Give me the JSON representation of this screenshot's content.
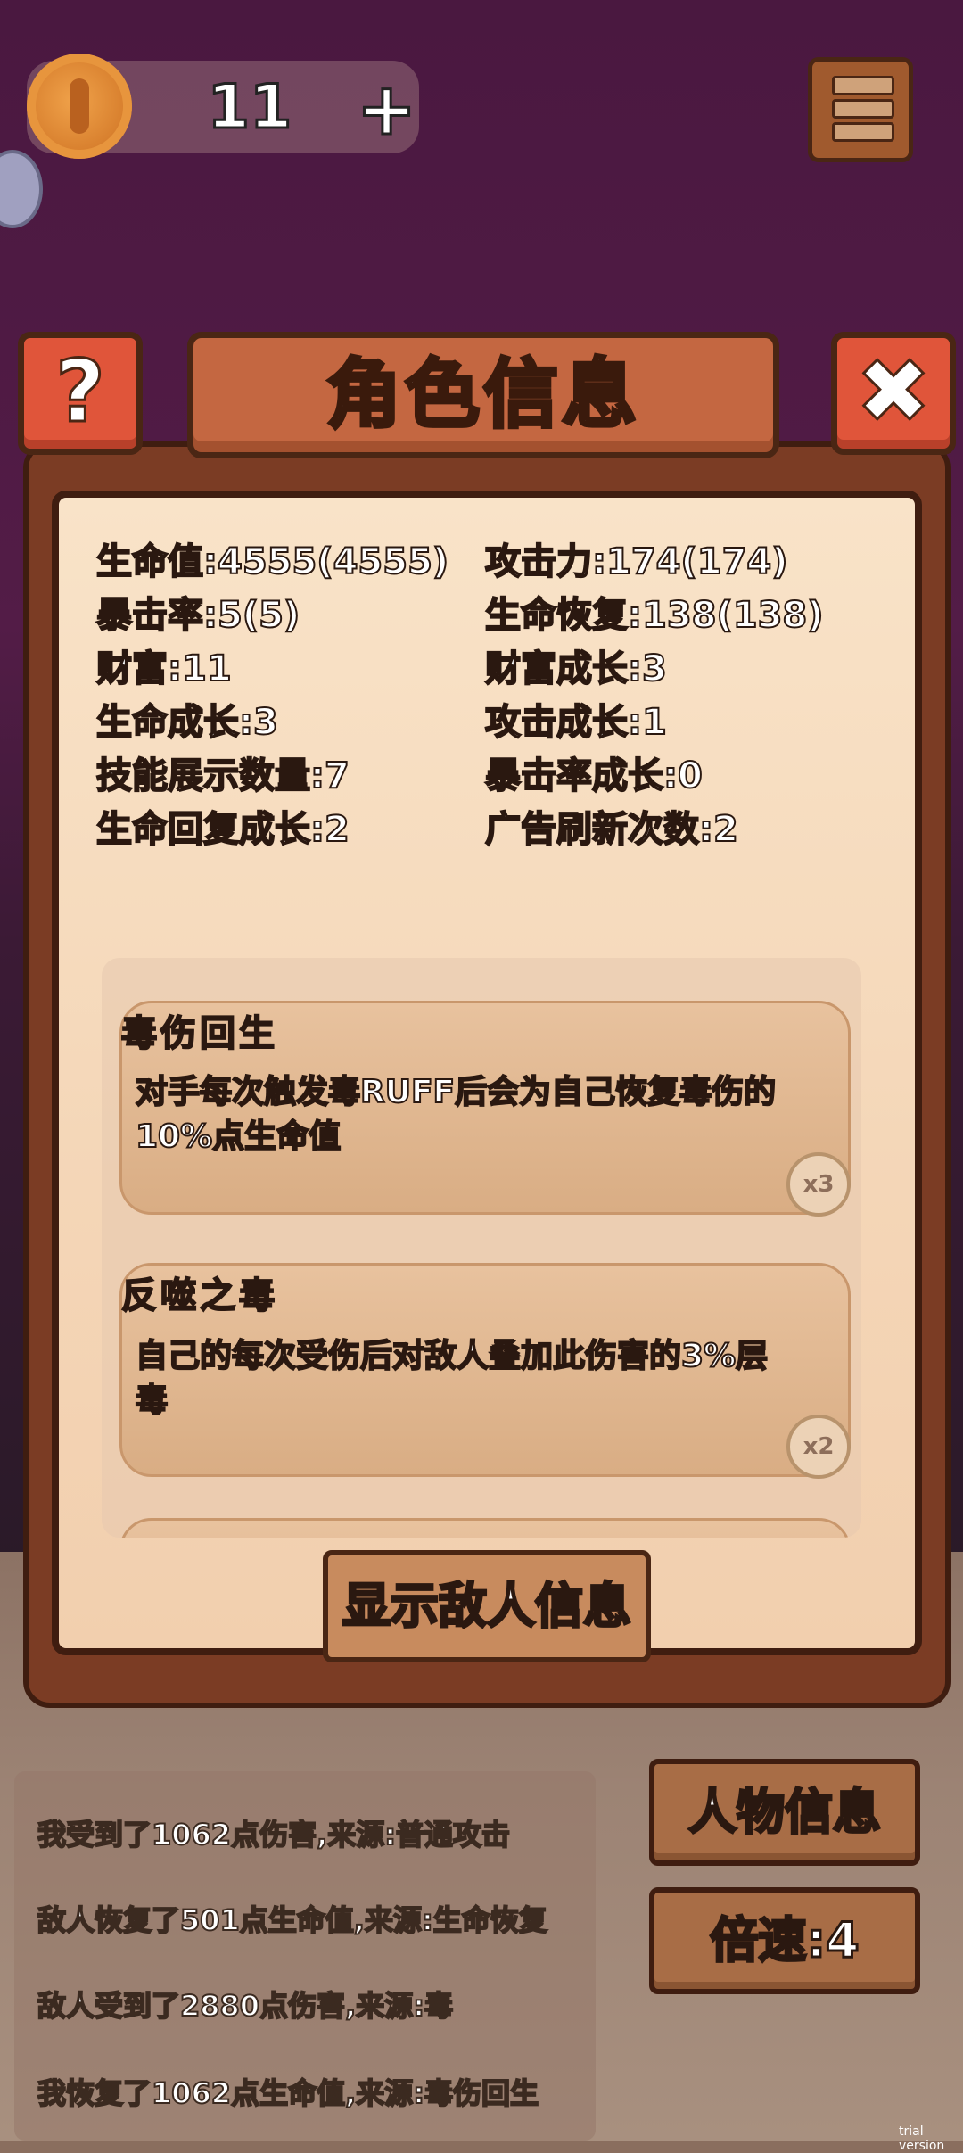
{
  "hud": {
    "coins": "11",
    "plus": "+"
  },
  "panel": {
    "title": "角色信息",
    "help_label": "?",
    "close_label": "✖",
    "stats": [
      {
        "left": "生命值:4555(4555)",
        "right": "攻击力:174(174)"
      },
      {
        "left": "暴击率:5(5)",
        "right": "生命恢复:138(138)"
      },
      {
        "left": "财富:11",
        "right": "财富成长:3"
      },
      {
        "left": "生命成长:3",
        "right": "攻击成长:1"
      },
      {
        "left": "技能展示数量:7",
        "right": "暴击率成长:0"
      },
      {
        "left": "生命回复成长:2",
        "right": "广告刷新次数:2"
      }
    ],
    "skills": [
      {
        "name": "毒伤回生",
        "name_color": "#c9c2ff",
        "desc": "对手每次触发毒RUFF后会为自己恢复毒伤的10%点生命值",
        "mult": "x3"
      },
      {
        "name": "反噬之毒",
        "name_color": "#ff9fb5",
        "desc": "自己的每次受伤后对敌人叠加此伤害的3%层毒",
        "mult": "x2"
      }
    ],
    "show_enemy_label": "显示敌人信息"
  },
  "log": [
    "我受到了1062点伤害,来源:普通攻击",
    "敌人恢复了501点生命值,来源:生命恢复",
    "敌人受到了2880点伤害,来源:毒",
    "我恢复了1062点生命值,来源:毒伤回生"
  ],
  "buttons": {
    "character_info": "人物信息",
    "speed": "倍速:4"
  },
  "watermark": "trial version",
  "colors": {
    "panel_wood": "#7b3c24",
    "title_board": "#c46741",
    "parchment": "#f6dcc0"
  }
}
